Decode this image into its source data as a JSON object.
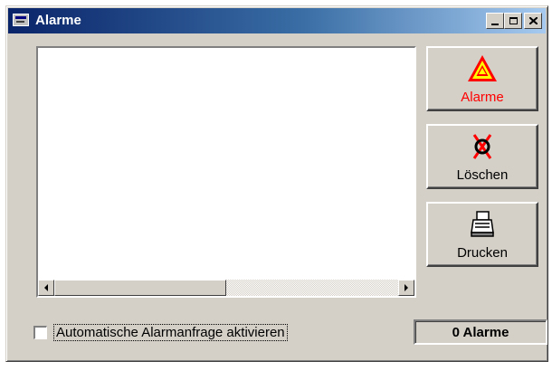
{
  "window": {
    "title": "Alarme",
    "title_icon": "app-window-icon",
    "controls": [
      "minimize",
      "maximize",
      "close"
    ]
  },
  "alarm_list": {
    "items": []
  },
  "buttons": {
    "alarme": {
      "label": "Alarme",
      "icon": "warning-triangle-icon",
      "label_color": "#ff0000"
    },
    "loeschen": {
      "label": "Löschen",
      "icon": "delete-x-icon"
    },
    "drucken": {
      "label": "Drucken",
      "icon": "printer-icon"
    }
  },
  "auto_query": {
    "label": "Automatische Alarmanfrage aktivieren",
    "checked": false
  },
  "status": {
    "count_text": "0 Alarme"
  },
  "colors": {
    "title_bar_start": "#0a246a",
    "title_bar_end": "#a6caf0",
    "face": "#d4d0c8",
    "alarm_accent": "#ff0000",
    "warning_fill": "#ffff00"
  }
}
